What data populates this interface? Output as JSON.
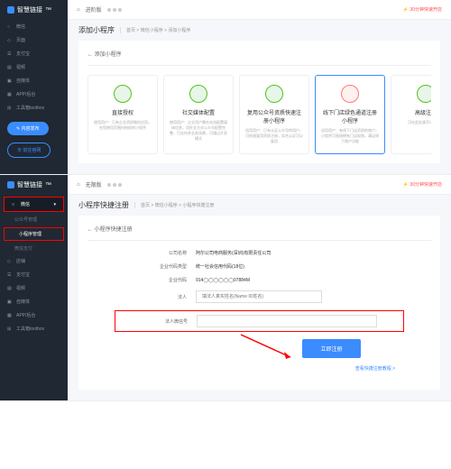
{
  "brand": "智慧链接",
  "topbar": {
    "left": "进阶版",
    "right": "⚡ 30分钟快速开店"
  },
  "sidebar_top": {
    "items": [
      {
        "icon": "○",
        "label": "微信"
      },
      {
        "icon": "◇",
        "label": "页面"
      },
      {
        "icon": "☰",
        "label": "支付宝"
      },
      {
        "icon": "▤",
        "label": "视频"
      },
      {
        "icon": "▣",
        "label": "自媒体"
      },
      {
        "icon": "▦",
        "label": "APP/后台"
      },
      {
        "icon": "⊞",
        "label": "工具箱toolbox"
      }
    ],
    "btn_publish": "✎ 内容发布",
    "btn_site": "⊕ 前往官网"
  },
  "sidebar_bottom": {
    "items": [
      {
        "icon": "○",
        "label": "微信",
        "active": true
      },
      {
        "icon": "◇",
        "label": "店铺"
      },
      {
        "icon": "☰",
        "label": "支付宝"
      },
      {
        "icon": "▤",
        "label": "视频"
      },
      {
        "icon": "▣",
        "label": "自媒体"
      },
      {
        "icon": "▦",
        "label": "APP/后台"
      },
      {
        "icon": "⊞",
        "label": "工具箱toolbox"
      }
    ],
    "subs": [
      "公众号管理",
      "小程序管理",
      "微信支付"
    ]
  },
  "page1": {
    "title": "添加小程序",
    "crumb": "首页 > 微信小程序 > 添加小程序",
    "back": "← 添加小程序",
    "cards": [
      {
        "color": "#52c41a",
        "title": "直接授权",
        "desc": "使用用户：已有企业资质微信应用，在您使用范围内授权的小程序"
      },
      {
        "color": "#52c41a",
        "title": "社交媒体配置",
        "desc": "使用用户：企业用户需在本站配置媒体信息，用社交方式公众号配置完整，可支持多业务场景，可通过开发模式"
      },
      {
        "color": "#52c41a",
        "title": "复用公众号资质快速注册小程序",
        "desc": "适用用户：已有认证公众号的用户，可快速复用资质注册，实名认证可以复用"
      },
      {
        "color": "#ff7875",
        "title": "线下门店绿色通道注册小程序",
        "desc": "适用用户：有线下门店资质的商户，小程序可直接拥有门店权限，满足线下商户功能"
      },
      {
        "color": "#52c41a",
        "title": "高级注册",
        "desc": "可在此处填写详细资料"
      }
    ]
  },
  "page2": {
    "title": "小程序快捷注册",
    "crumb": "首页 > 微信小程序 > 小程序快捷注册",
    "back": "← 小程序快捷注册",
    "form": {
      "company_label": "公司名称",
      "company_val": "阿尔公司电商服务(深圳)有限责任公司",
      "type_label": "企业代码类型",
      "type_val": "统一社会信用代码(18位)",
      "code_label": "企业代码",
      "code_val": "914◯◯◯◯◯◯07884M",
      "legal_label": "法人",
      "legal_placeholder": "填法人真实姓名(Name ID姓名)",
      "wechat_label": "法人微信号",
      "wechat_placeholder": "",
      "submit": "立即注册",
      "hint": "查看快捷注册教程 >"
    }
  },
  "topbar2": {
    "left": "无限版"
  }
}
